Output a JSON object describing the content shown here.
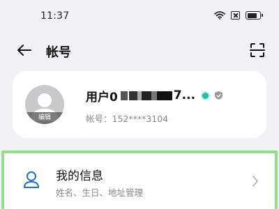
{
  "status_bar": {
    "time": "11:37",
    "icons": [
      "wifi-icon",
      "sim-icon",
      "battery-icon"
    ],
    "battery_level": 0.65
  },
  "header": {
    "title": "帐号",
    "back_icon": "arrow-left-icon",
    "scan_icon": "scan-icon"
  },
  "profile": {
    "username_prefix": "用户0",
    "username_suffix": "7...",
    "account_label": "帐号：152****3104",
    "avatar_edit_label": "编辑",
    "verified_color": "#1fc0a8"
  },
  "menu": {
    "items": [
      {
        "title": "我的信息",
        "subtitle": "姓名、生日、地址管理",
        "icon": "person-icon"
      }
    ]
  },
  "colors": {
    "background": "#f2f2f4",
    "card": "#ffffff",
    "highlight_border": "#8ee08a",
    "accent": "#1a6fd6"
  }
}
